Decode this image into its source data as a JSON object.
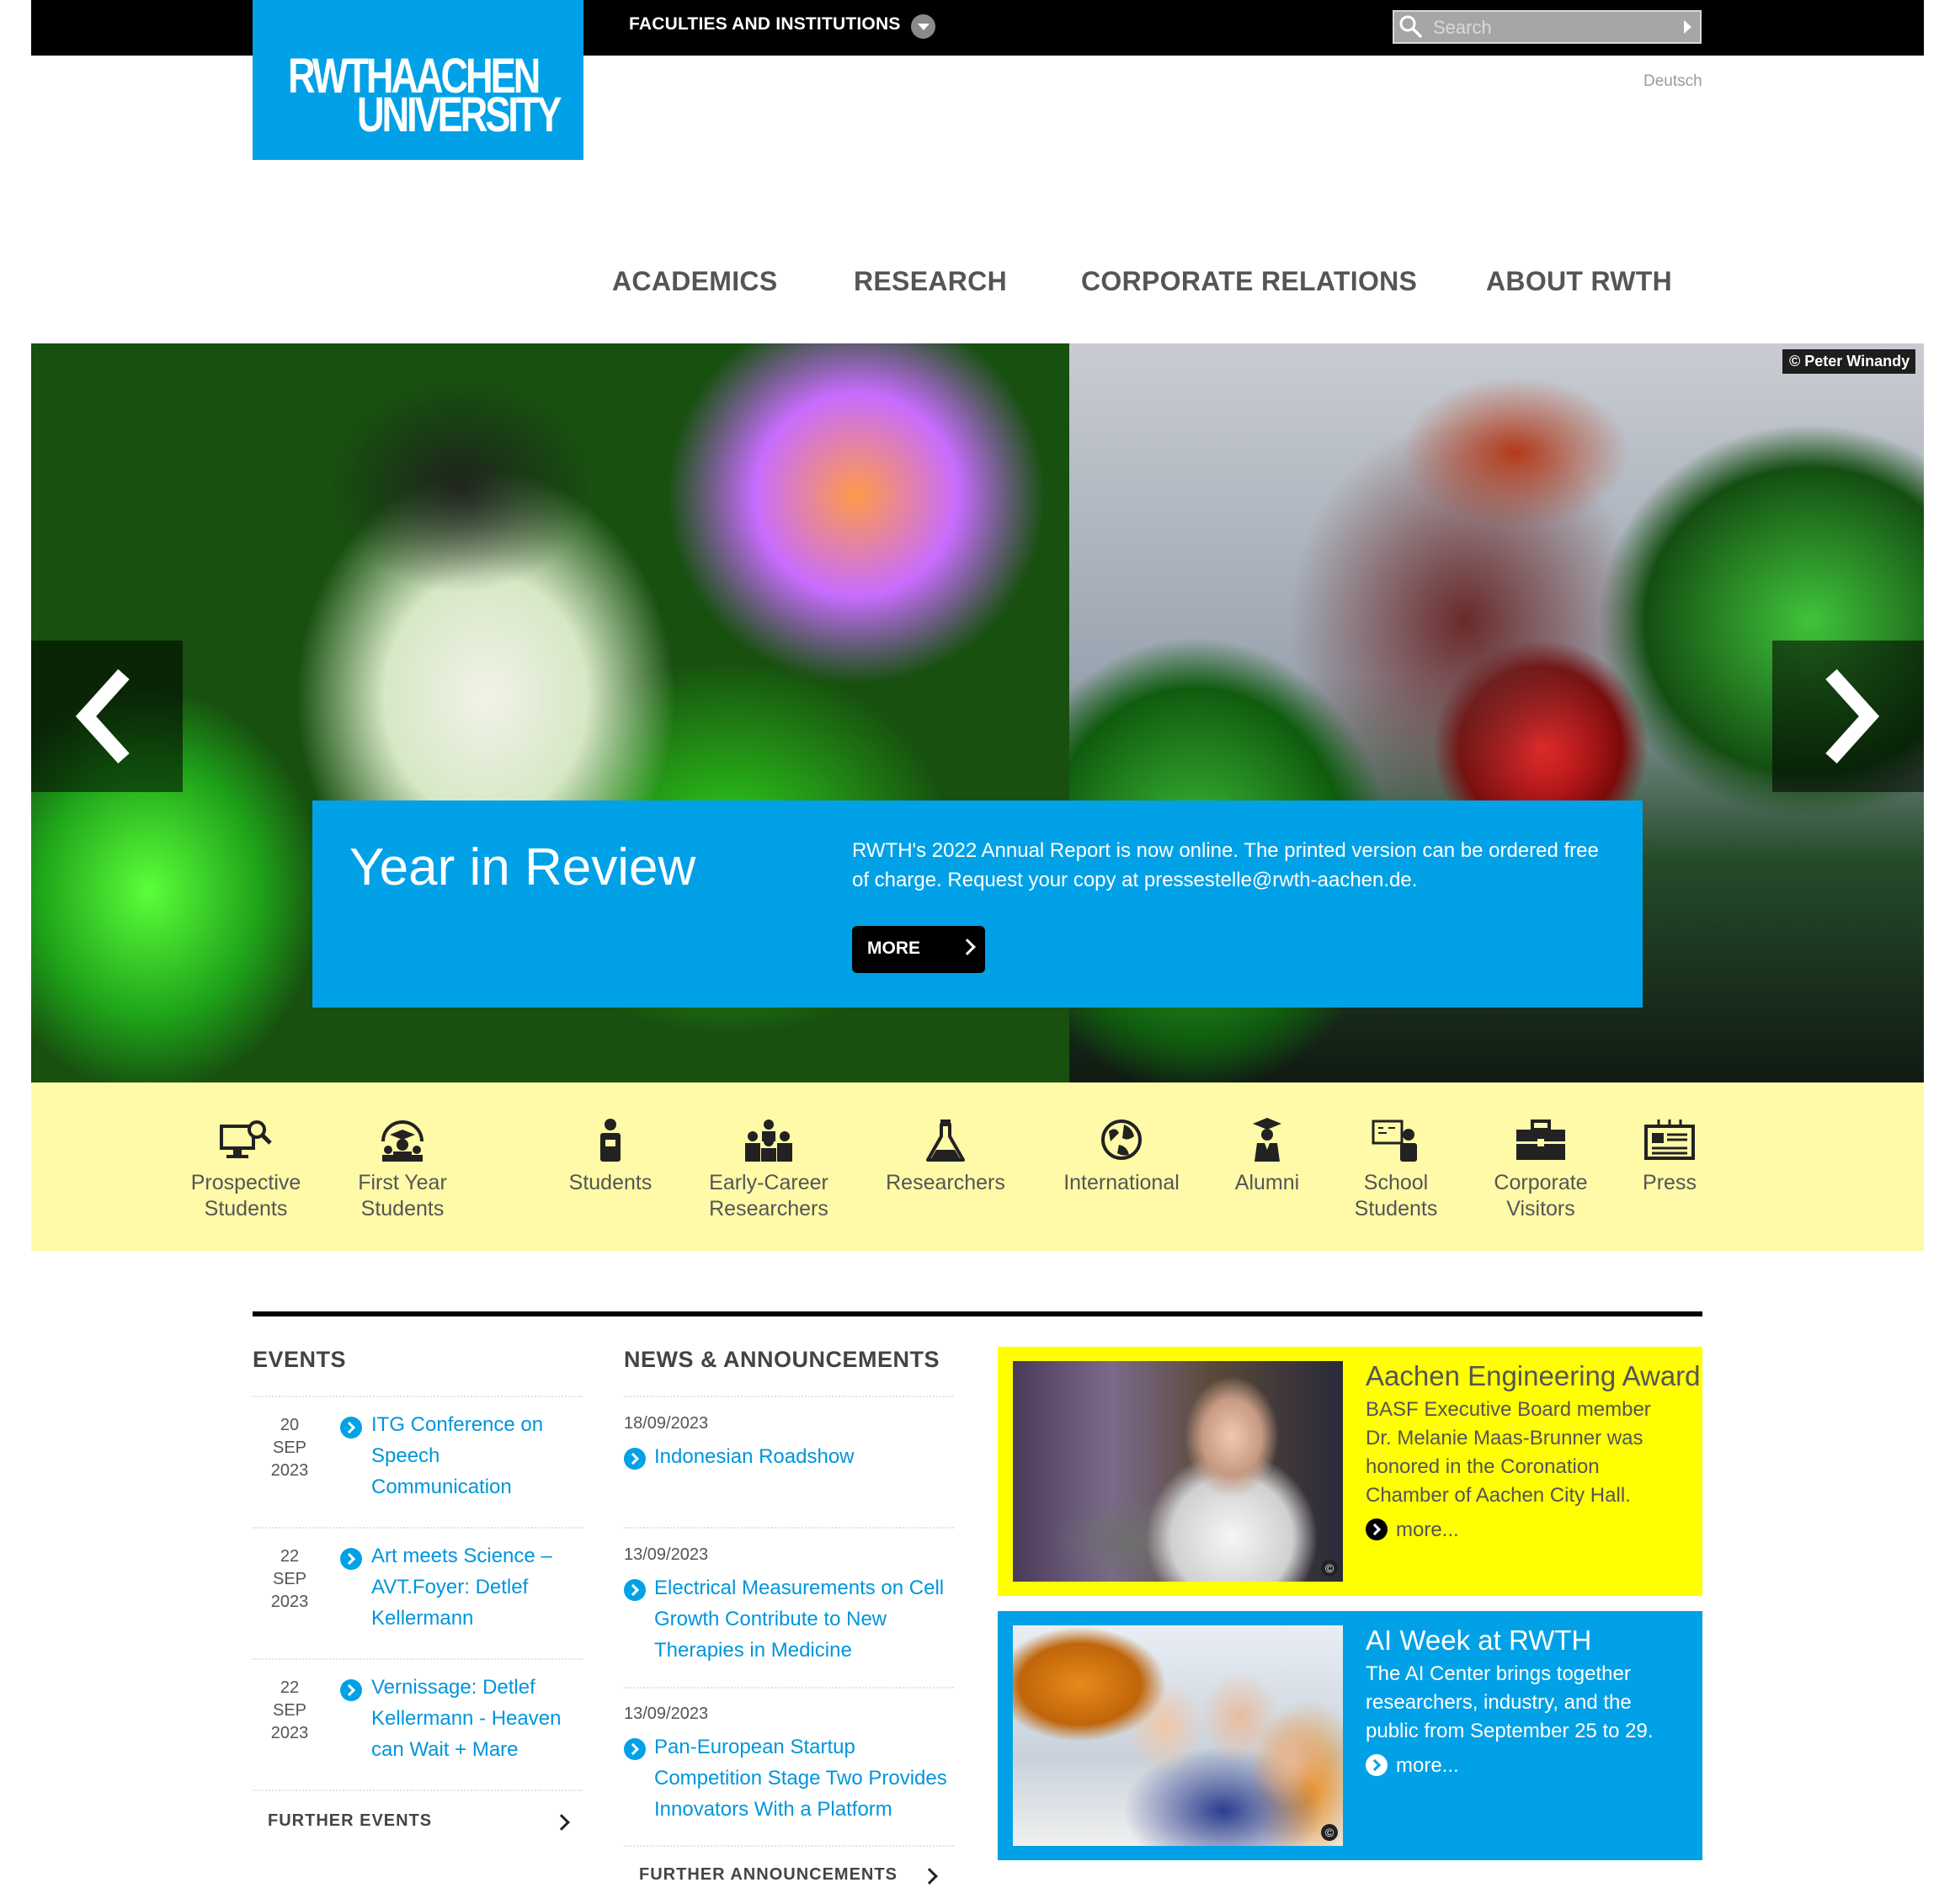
{
  "header": {
    "logo_line1": "RWTHAACHEN",
    "logo_line2": "UNIVERSITY",
    "faculties_label": "FACULTIES AND INSTITUTIONS",
    "search_placeholder": "Search",
    "language_link": "Deutsch"
  },
  "nav": {
    "items": [
      "ACADEMICS",
      "RESEARCH",
      "CORPORATE RELATIONS",
      "ABOUT RWTH"
    ]
  },
  "hero": {
    "photo_credit": "© Peter Winandy",
    "title": "Year in Review",
    "text": "RWTH's 2022 Annual Report is now online. The printed version can be ordered free of charge. Request your copy at pressestelle@rwth-aachen.de.",
    "more_label": "MORE"
  },
  "audience": {
    "items": [
      {
        "line1": "Prospective",
        "line2": "Students",
        "icon": "monitor-search-icon"
      },
      {
        "line1": "First Year",
        "line2": "Students",
        "icon": "graduate-group-icon"
      },
      {
        "line1": "Students",
        "line2": "",
        "icon": "student-icon"
      },
      {
        "line1": "Early-Career",
        "line2": "Researchers",
        "icon": "team-icon"
      },
      {
        "line1": "Researchers",
        "line2": "",
        "icon": "flask-icon"
      },
      {
        "line1": "International",
        "line2": "",
        "icon": "globe-icon"
      },
      {
        "line1": "Alumni",
        "line2": "",
        "icon": "graduate-icon"
      },
      {
        "line1": "School",
        "line2": "Students",
        "icon": "classroom-icon"
      },
      {
        "line1": "Corporate",
        "line2": "Visitors",
        "icon": "briefcase-icon"
      },
      {
        "line1": "Press",
        "line2": "",
        "icon": "newspaper-icon"
      }
    ]
  },
  "events": {
    "heading": "EVENTS",
    "items": [
      {
        "day": "20",
        "month": "SEP",
        "year": "2023",
        "title_lines": [
          "ITG Conference on",
          "Speech",
          "Communication"
        ]
      },
      {
        "day": "22",
        "month": "SEP",
        "year": "2023",
        "title_lines": [
          "Art meets Science –",
          "AVT.Foyer: Detlef",
          "Kellermann"
        ]
      },
      {
        "day": "22",
        "month": "SEP",
        "year": "2023",
        "title_lines": [
          "Vernissage: Detlef",
          "Kellermann - Heaven",
          "can Wait + Mare"
        ]
      }
    ],
    "further_label": "FURTHER EVENTS"
  },
  "news": {
    "heading": "NEWS & ANNOUNCEMENTS",
    "items": [
      {
        "date": "18/09/2023",
        "title_lines": [
          "Indonesian Roadshow"
        ]
      },
      {
        "date": "13/09/2023",
        "title_lines": [
          "Electrical Measurements on Cell",
          "Growth Contribute to New",
          "Therapies in Medicine"
        ]
      },
      {
        "date": "13/09/2023",
        "title_lines": [
          "Pan-European Startup",
          "Competition Stage Two Provides",
          "Innovators With a Platform"
        ]
      }
    ],
    "further_label": "FURTHER ANNOUNCEMENTS"
  },
  "features": [
    {
      "title": "Aachen Engineering Award",
      "text_lines": [
        "BASF Executive Board member",
        "Dr. Melanie Maas-Brunner was",
        "honored in the Coronation",
        "Chamber of Aachen City Hall."
      ],
      "more": "more...",
      "copyright": "©",
      "bg_color": "#ffff00"
    },
    {
      "title": "AI Week at RWTH",
      "text_lines": [
        "The AI Center brings together",
        "researchers, industry, and the",
        "public from September 25 to 29."
      ],
      "more": "more...",
      "copyright": "©",
      "bg_color": "#00a1e6"
    }
  ],
  "colors": {
    "brand_blue": "#00a1e6",
    "audience_yellow": "#fffaa8",
    "card_yellow": "#ffff00",
    "topbar": "#000000"
  }
}
